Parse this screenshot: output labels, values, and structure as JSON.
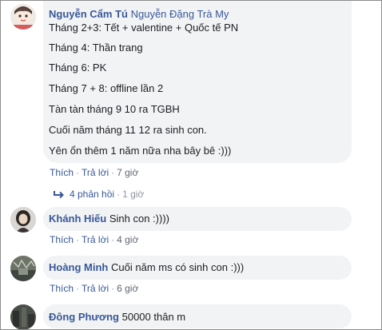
{
  "comments": [
    {
      "author": "Nguyễn Cẩm Tú",
      "mention": "Nguyễn Đặng Trà My",
      "lines": [
        "Tháng 2+3: Tết + valentine + Quốc tế PN",
        "Tháng 4: Thần trang",
        "Tháng 6: PK",
        "Tháng 7 + 8: offline lần 2",
        "Tàn tàn tháng 9 10 ra TGBH",
        "Cuối năm tháng 11 12 ra sinh con.",
        "Yên ổn thêm 1 năm nữa nha bây bê :)))"
      ],
      "like_label": "Thích",
      "reply_label": "Trả lời",
      "time": "7 giờ",
      "replies_label": "4 phản hồi",
      "replies_time": "1 giờ"
    },
    {
      "author": "Khánh Hiếu",
      "text": "Sinh con :))))",
      "like_label": "Thích",
      "reply_label": "Trả lời",
      "time": "4 giờ"
    },
    {
      "author": "Hoàng Minh",
      "text": "Cuối năm ms có sinh con :)))",
      "like_label": "Thích",
      "reply_label": "Trả lời",
      "time": "6 giờ"
    },
    {
      "author": "Đông Phương",
      "text": "50000 thân m"
    }
  ],
  "separator": "·",
  "icons": {
    "reply_arrow": "reply-arrow-icon"
  },
  "colors": {
    "link": "#385898",
    "bubble": "#f2f3f5",
    "meta": "#90949c"
  }
}
